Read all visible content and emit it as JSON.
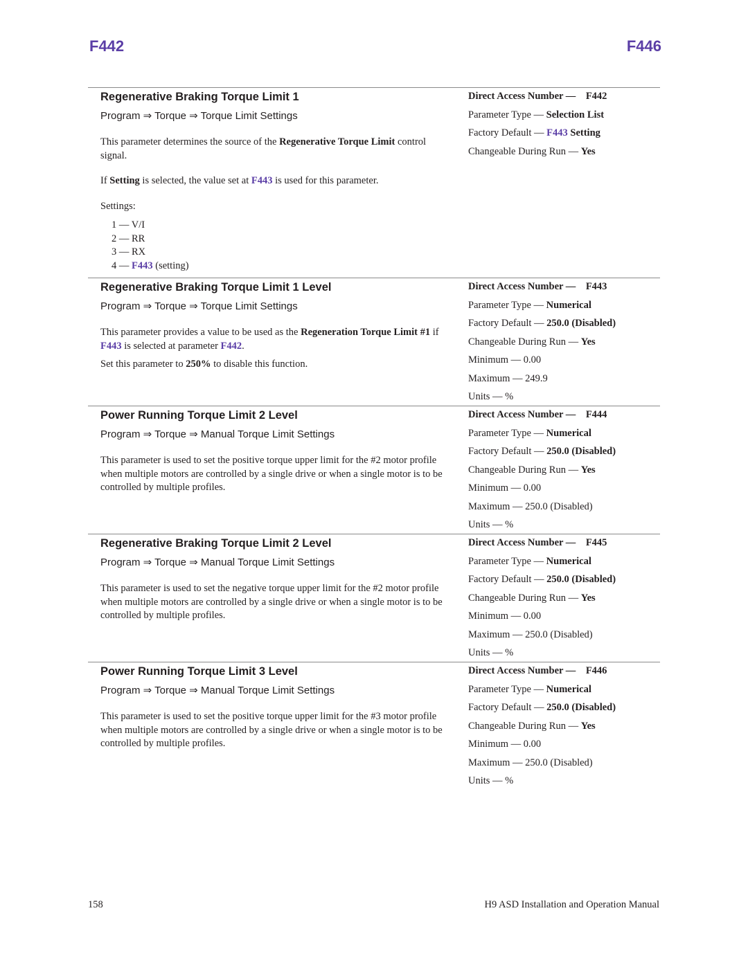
{
  "header": {
    "left_code": "F442",
    "right_code": "F446"
  },
  "labels": {
    "direct_access": "Direct Access Number —",
    "parameter_type": "Parameter Type —",
    "factory_default": "Factory Default —",
    "changeable": "Changeable During Run —",
    "minimum": "Minimum —",
    "maximum": "Maximum —",
    "units": "Units —",
    "dash": "—"
  },
  "sections": [
    {
      "title": "Regenerative Braking Torque Limit 1",
      "path": "Program ⇒ Torque  ⇒ Torque Limit Settings",
      "desc_pre": "This parameter determines the source of the ",
      "desc_bold": "Regenerative Torque Limit",
      "desc_post": " control signal.",
      "note_pre": "If ",
      "note_bold": "Setting",
      "note_mid": " is selected, the value set at ",
      "note_link": "F443",
      "note_post": " is used for this parameter.",
      "settings_label": "Settings:",
      "settings": [
        {
          "num": "1",
          "value": "V/I"
        },
        {
          "num": "2",
          "value": "RR"
        },
        {
          "num": "3",
          "value": "RX"
        },
        {
          "num": "4",
          "link": "F443",
          "value": " (setting)"
        }
      ],
      "props": {
        "direct_access_number": "F442",
        "parameter_type": "Selection List",
        "factory_default_link": "F443",
        "factory_default": " Setting",
        "changeable": "Yes"
      }
    },
    {
      "title": "Regenerative Braking Torque Limit 1 Level",
      "path": "Program ⇒ Torque ⇒ Torque Limit Settings",
      "desc_pre": "This parameter provides a value to be used as the ",
      "desc_bold": "Regeneration Torque Limit #1",
      "desc_mid": " if ",
      "desc_link1": "F443",
      "desc_mid2": " is selected at parameter ",
      "desc_link2": "F442",
      "desc_post": ".",
      "note_pre": "Set this parameter to ",
      "note_bold": "250%",
      "note_post": " to disable this function.",
      "props": {
        "direct_access_number": "F443",
        "parameter_type": "Numerical",
        "factory_default": "250.0 (Disabled)",
        "changeable": "Yes",
        "minimum": "0.00",
        "maximum": "249.9",
        "units": "%"
      }
    },
    {
      "title": "Power Running Torque Limit 2 Level",
      "path": "Program ⇒ Torque ⇒ Manual Torque Limit Settings",
      "desc": "This parameter is used to set the positive torque upper limit for the #2 motor profile when multiple motors are controlled by a single drive or when a single motor is to be controlled by multiple profiles.",
      "props": {
        "direct_access_number": "F444",
        "parameter_type": "Numerical",
        "factory_default": "250.0 (Disabled)",
        "changeable": "Yes",
        "minimum": "0.00",
        "maximum": "250.0 (Disabled)",
        "units": "%"
      }
    },
    {
      "title": "Regenerative Braking Torque Limit 2 Level",
      "path": "Program ⇒ Torque ⇒ Manual Torque Limit Settings",
      "desc": "This parameter is used to set the negative torque upper limit for the #2 motor profile when multiple motors are controlled by a single drive or when a single motor is to be controlled by multiple profiles.",
      "props": {
        "direct_access_number": "F445",
        "parameter_type": "Numerical",
        "factory_default": "250.0 (Disabled)",
        "changeable": "Yes",
        "minimum": "0.00",
        "maximum": "250.0 (Disabled)",
        "units": "%"
      }
    },
    {
      "title": "Power Running Torque Limit 3 Level",
      "path": "Program ⇒ Torque ⇒ Manual Torque Limit Settings",
      "desc": "This parameter is used to set the positive torque upper limit for the #3 motor profile when multiple motors are controlled by a single drive or when a single motor is to be controlled by multiple profiles.",
      "props": {
        "direct_access_number": "F446",
        "parameter_type": "Numerical",
        "factory_default": "250.0 (Disabled)",
        "changeable": "Yes",
        "minimum": "0.00",
        "maximum": "250.0 (Disabled)",
        "units": "%"
      }
    }
  ],
  "footer": {
    "page_number": "158",
    "manual_title": "H9 ASD Installation and Operation Manual"
  },
  "colors": {
    "accent": "#5b3ea6",
    "text": "#231f20",
    "rule": "#8a8a8a"
  }
}
